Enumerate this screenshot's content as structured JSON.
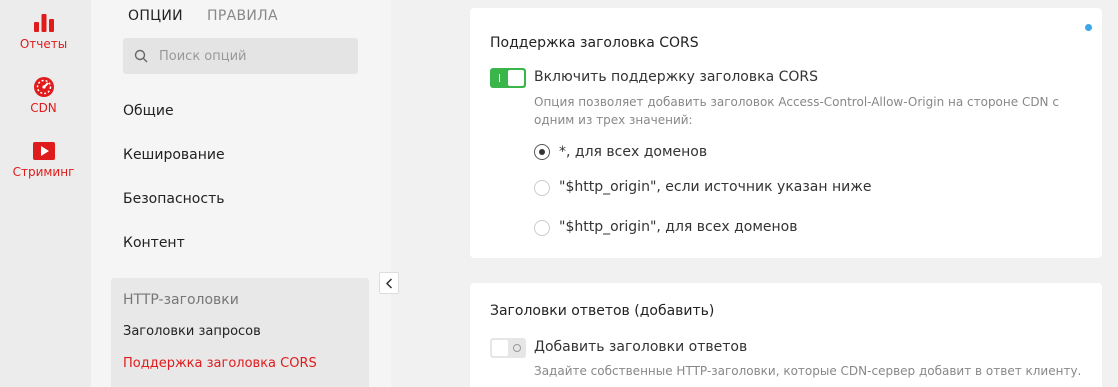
{
  "rail": {
    "items": [
      {
        "label": "Отчеты",
        "icon": "bar-chart-icon"
      },
      {
        "label": "CDN",
        "icon": "speedometer-icon"
      },
      {
        "label": "Стриминг",
        "icon": "play-icon"
      }
    ],
    "accent": "#e01b1b"
  },
  "options": {
    "tabs": [
      "ОПЦИИ",
      "ПРАВИЛА"
    ],
    "search_placeholder": "Поиск опций",
    "menu": [
      "Общие",
      "Кеширование",
      "Безопасность",
      "Контент"
    ],
    "group": {
      "title": "HTTP-заголовки",
      "links": [
        "Заголовки запросов",
        "Поддержка заголовка CORS"
      ],
      "active_index": 1
    }
  },
  "cors_card": {
    "title": "Поддержка заголовка CORS",
    "toggle_label": "Включить поддержку заголовка CORS",
    "toggle_on": true,
    "hint": "Опция позволяет добавить заголовок Access-Control-Allow-Origin на стороне CDN с одним из трех значений:",
    "options": [
      "*, для всех доменов",
      "\"$http_origin\", если источник указан ниже",
      "\"$http_origin\", для всех доменов"
    ],
    "selected_index": 0
  },
  "response_card": {
    "title": "Заголовки ответов (добавить)",
    "toggle_label": "Добавить заголовки ответов",
    "toggle_on": false,
    "hint": "Задайте собственные HTTP-заголовки, которые CDN-сервер добавит в ответ клиенту."
  }
}
